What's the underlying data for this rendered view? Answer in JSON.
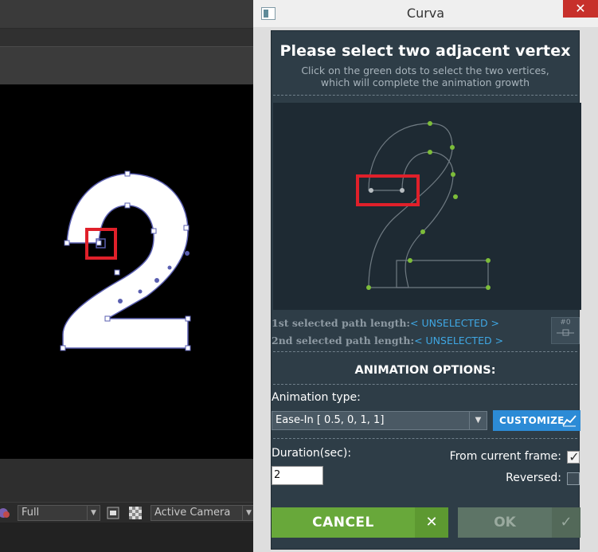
{
  "window": {
    "title": "Curva",
    "close_glyph": "✕"
  },
  "header": {
    "title": "Please select two adjacent vertex",
    "subtitle_line1": "Click on the green dots to select the two vertices,",
    "subtitle_line2": "which will complete the animation growth"
  },
  "paths": {
    "first_label": "1st selected path length:",
    "first_value": "< UNSELECTED >",
    "second_label": "2nd selected path length:",
    "second_value": "< UNSELECTED >",
    "node_button_text": "#0"
  },
  "animation": {
    "section_title": "ANIMATION OPTIONS:",
    "type_label": "Animation type:",
    "type_value": "Ease-In [ 0.5, 0, 1, 1]",
    "customize_label": "CUSTOMIZE",
    "duration_label": "Duration(sec):",
    "duration_value": "2",
    "from_current_label": "From current frame:",
    "from_current_checked": true,
    "reversed_label": "Reversed:",
    "reversed_checked": false
  },
  "buttons": {
    "cancel_label": "CANCEL",
    "cancel_glyph": "✕",
    "ok_label": "OK",
    "ok_glyph": "✓"
  },
  "ae": {
    "resolution_value": "Full",
    "camera_value": "Active Camera"
  },
  "colors": {
    "panel_bg": "#2e3d47",
    "accent_blue": "#2c8bd6",
    "cancel_green": "#68a83a",
    "ok_disabled": "#5d7466",
    "vertex_green": "#7dbd3a",
    "highlight_red": "#e0202a"
  }
}
